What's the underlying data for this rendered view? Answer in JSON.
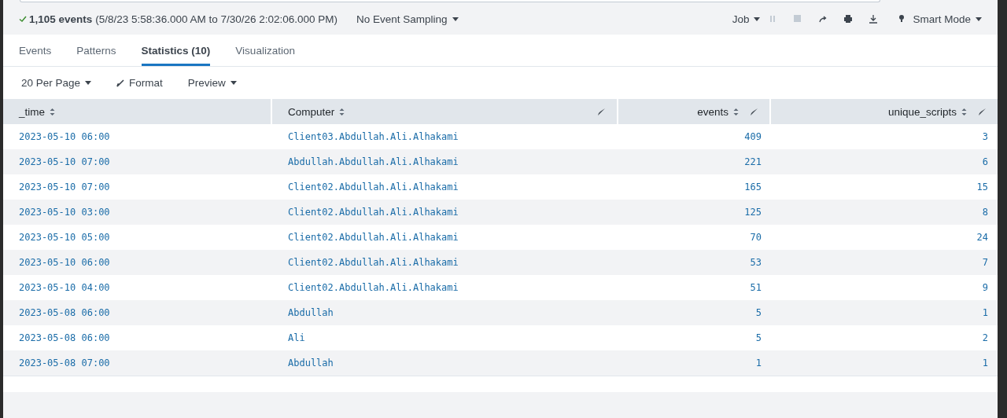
{
  "status": {
    "count": "1,105 events",
    "range": "(5/8/23 5:58:36.000 AM to 7/30/26 2:02:06.000 PM)",
    "sampling": "No Event Sampling",
    "job": "Job",
    "mode": "Smart Mode"
  },
  "job_controls": [
    {
      "kind": "pause",
      "disabled": true
    },
    {
      "kind": "stop",
      "disabled": true
    },
    {
      "kind": "share",
      "disabled": false
    },
    {
      "kind": "print",
      "disabled": false
    },
    {
      "kind": "export",
      "disabled": false
    }
  ],
  "tabs": [
    {
      "label": "Events",
      "selected": false
    },
    {
      "label": "Patterns",
      "selected": false
    },
    {
      "label": "Statistics (10)",
      "selected": true
    },
    {
      "label": "Visualization",
      "selected": false
    }
  ],
  "toolbar": [
    {
      "label": "20 Per Page",
      "kind": "dropdown"
    },
    {
      "label": "Format",
      "kind": "brush"
    },
    {
      "label": "Preview",
      "kind": "dropdown"
    }
  ],
  "table": {
    "columns": [
      {
        "label": "_time",
        "editable": false
      },
      {
        "label": "Computer",
        "editable": true
      },
      {
        "label": "events",
        "editable": true
      },
      {
        "label": "unique_scripts",
        "editable": true
      }
    ],
    "rows": [
      [
        "2023-05-10 06:00",
        "Client03.Abdullah.Ali.Alhakami",
        "409",
        "3"
      ],
      [
        "2023-05-10 07:00",
        "Abdullah.Abdullah.Ali.Alhakami",
        "221",
        "6"
      ],
      [
        "2023-05-10 07:00",
        "Client02.Abdullah.Ali.Alhakami",
        "165",
        "15"
      ],
      [
        "2023-05-10 03:00",
        "Client02.Abdullah.Ali.Alhakami",
        "125",
        "8"
      ],
      [
        "2023-05-10 05:00",
        "Client02.Abdullah.Ali.Alhakami",
        "70",
        "24"
      ],
      [
        "2023-05-10 06:00",
        "Client02.Abdullah.Ali.Alhakami",
        "53",
        "7"
      ],
      [
        "2023-05-10 04:00",
        "Client02.Abdullah.Ali.Alhakami",
        "51",
        "9"
      ],
      [
        "2023-05-08 06:00",
        "Abdullah",
        "5",
        "1"
      ],
      [
        "2023-05-08 06:00",
        "Ali",
        "5",
        "2"
      ],
      [
        "2023-05-08 07:00",
        "Abdullah",
        "1",
        "1"
      ]
    ]
  }
}
